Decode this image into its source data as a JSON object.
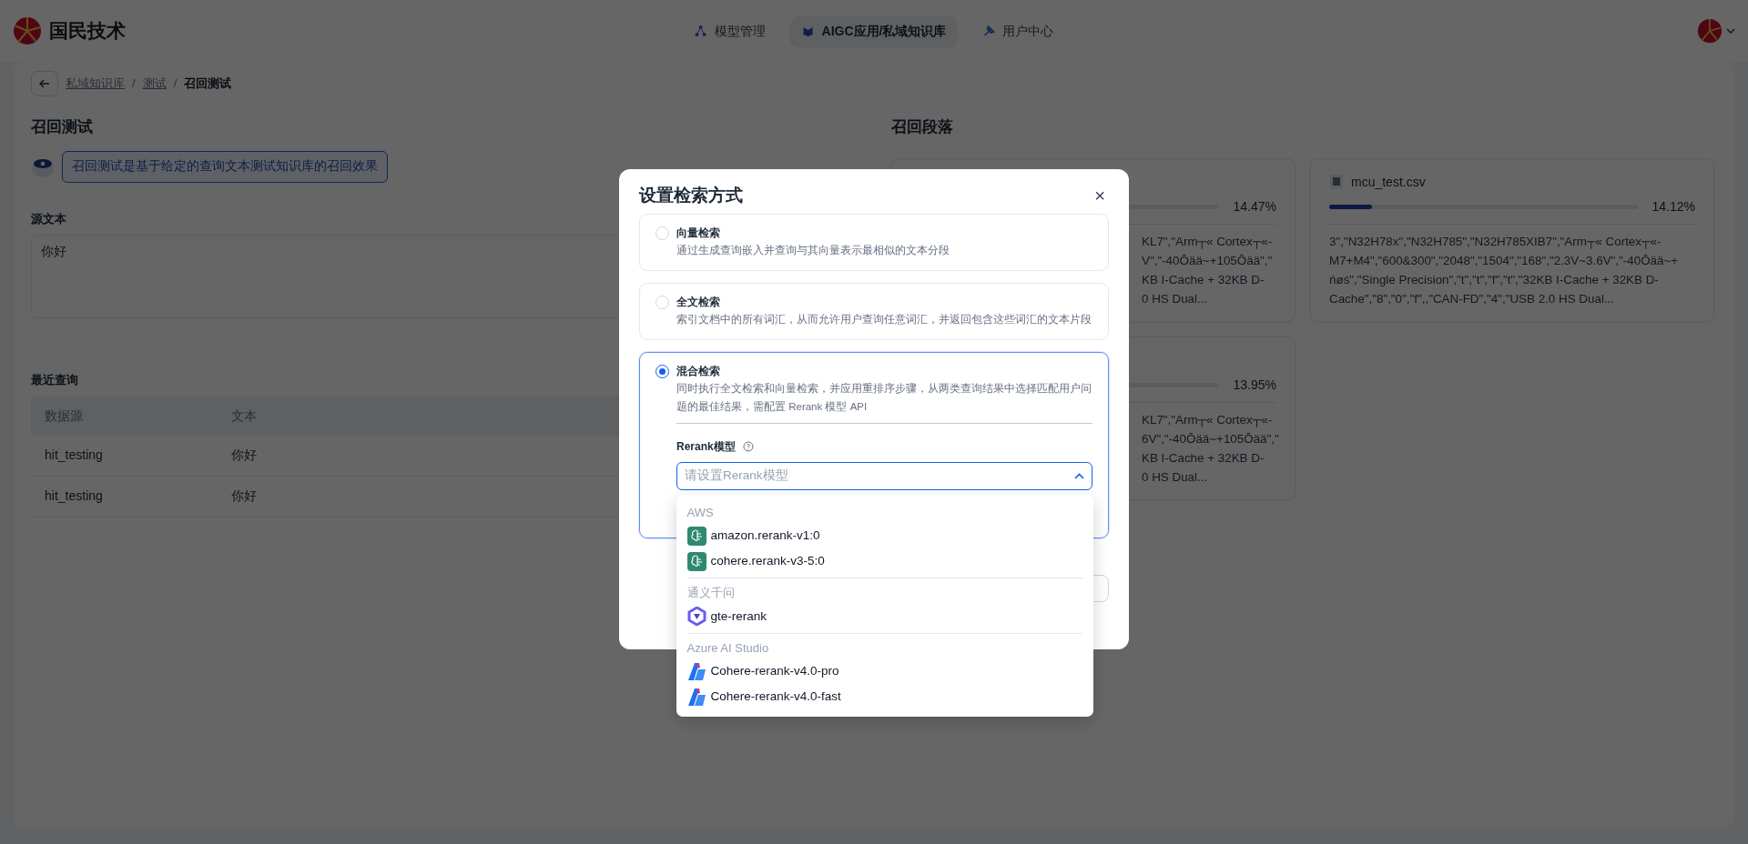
{
  "header": {
    "logo_text": "国民技术",
    "nav": [
      {
        "label": "模型管理",
        "selected": false
      },
      {
        "label": "AIGC应用/私域知识库",
        "selected": true
      },
      {
        "label": "用户中心",
        "selected": false
      }
    ]
  },
  "breadcrumb": {
    "items": [
      "私域知识库",
      "测试",
      "召回测试"
    ],
    "separator": "/"
  },
  "left": {
    "title": "召回测试",
    "info": "召回测试是基于给定的查询文本测试知识库的召回效果",
    "source_label": "源文本",
    "source_text": "你好",
    "recent_title": "最近查询",
    "table": {
      "columns": [
        "数据源",
        "文本"
      ],
      "rows": [
        [
          "hit_testing",
          "你好"
        ],
        [
          "hit_testing",
          "你好"
        ]
      ]
    }
  },
  "results": {
    "title": "召回段落",
    "cards": [
      {
        "covered": true,
        "score": "14.47%",
        "lines": [
          "KL7\",\"Arm┬« Cortex┬«-",
          "V\",\"-40Ōää~+105Ōää\",\"",
          "KB I-Cache + 32KB D-",
          "0 HS Dual..."
        ]
      },
      {
        "covered": false,
        "file_name": "mcu_test.csv",
        "score": "14.12%",
        "level": 0.14,
        "lines": [
          "3\",\"N32H78x\",\"N32H785\",\"N32H785XIB7\",\"Arm┬« Cortex┬«-",
          "M7+M4\",\"600&300\",\"2048\",\"1504\",\"168\",\"2.3V~3.6V\",\"-40Ōää~+",
          "ńøś\",\"Single Precision\",\"t\",\"t\",\"f\",\"t\",\"32KB I-Cache + 32KB D-",
          "Cache\",\"8\",\"0\",\"f\",,\"CAN-FD\",\"4\",\"USB 2.0 HS Dual..."
        ]
      },
      {
        "covered": true,
        "score": "13.95%",
        "lines": [
          "KL7\",\"Arm┬« Cortex┬«-",
          "6V\",\"-40Ōää~+105Ōää\",\"",
          "KB I-Cache + 32KB D-",
          "0 HS Dual..."
        ]
      }
    ]
  },
  "modal": {
    "title": "设置检索方式",
    "close": "×",
    "options": [
      {
        "title": "向量检索",
        "description": "通过生成查询嵌入并查询与其向量表示最相似的文本分段",
        "selected": false
      },
      {
        "title": "全文检索",
        "description": "索引文档中的所有词汇，从而允许用户查询任意词汇，并返回包含这些词汇的文本片段",
        "selected": false
      },
      {
        "title": "混合检索",
        "description": "同时执行全文检索和向量检索，并应用重排序步骤，从两类查询结果中选择匹配用户问题的最佳结果，需配置 Rerank 模型 API",
        "selected": true
      }
    ],
    "rerank": {
      "label": "Rerank模型",
      "placeholder": "请设置Rerank模型",
      "expanded": true
    },
    "dropdown": [
      {
        "kind": "aws",
        "name": "AWS",
        "items": [
          "amazon.rerank-v1:0",
          "cohere.rerank-v3-5:0"
        ]
      },
      {
        "kind": "tongyi",
        "name": "通义千问",
        "items": [
          "gte-rerank"
        ]
      },
      {
        "kind": "azure",
        "name": "Azure AI Studio",
        "items": [
          "Cohere-rerank-v4.0-pro",
          "Cohere-rerank-v4.0-fast"
        ]
      }
    ]
  }
}
